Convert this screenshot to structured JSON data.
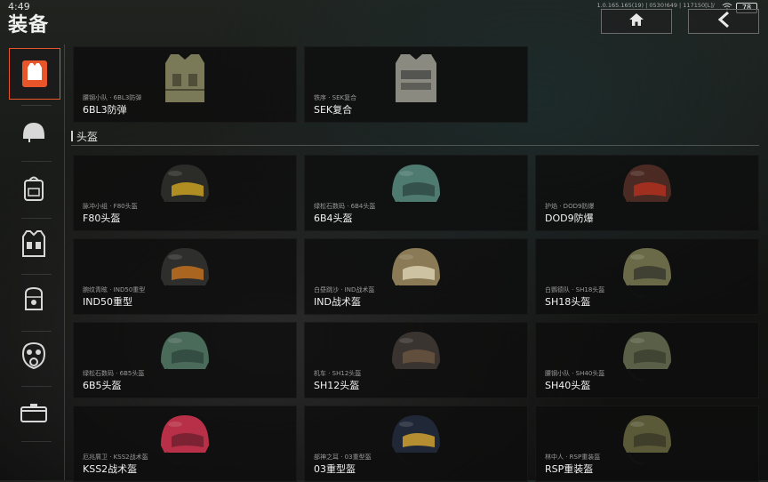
{
  "status": {
    "time": "4:49",
    "sysinfo": "1.0.165.165(19) | 0530!649 | 117150[L]/",
    "battery": "78"
  },
  "header": {
    "title": "装备",
    "home_icon": "home-icon",
    "back_icon": "back-arrow-icon"
  },
  "sidebar": {
    "items": [
      {
        "name": "vest-icon",
        "active": true
      },
      {
        "name": "helmet-icon",
        "active": false
      },
      {
        "name": "backpack-icon",
        "active": false
      },
      {
        "name": "chest-rig-icon",
        "active": false
      },
      {
        "name": "pouch-icon",
        "active": false
      },
      {
        "name": "gas-mask-icon",
        "active": false
      },
      {
        "name": "container-icon",
        "active": false
      }
    ]
  },
  "armor": [
    {
      "sub": "腰钢小队 · 6BL3防弹",
      "name": "6BL3防弹",
      "color": "#7a7a58"
    },
    {
      "sub": "铁序 · SEK复合",
      "name": "SEK复合",
      "color": "#8a8a80"
    }
  ],
  "section": {
    "helmets_label": "头盔"
  },
  "helmets": [
    {
      "sub": "脉冲小组 · F80头盔",
      "name": "F80头盔",
      "color": "#2b2b28",
      "visor": "#c8a020"
    },
    {
      "sub": "绿松石数码 · 6B4头盔",
      "name": "6B4头盔",
      "color": "#4f7a70",
      "visor": "#2f4a44"
    },
    {
      "sub": "护焰 · DOD9防爆",
      "name": "DOD9防爆",
      "color": "#4a2a22",
      "visor": "#b03020"
    },
    {
      "sub": "腕纹青眩 · IND50重型",
      "name": "IND50重型",
      "color": "#2e2e2c",
      "visor": "#c07020"
    },
    {
      "sub": "白昼跳沙 · IND战术盔",
      "name": "IND战术盔",
      "color": "#8a7a55",
      "visor": "#d8d0b0"
    },
    {
      "sub": "白鹦德队 · SH18头盔",
      "name": "SH18头盔",
      "color": "#6a6a48",
      "visor": "#3a3a30"
    },
    {
      "sub": "绿松石数码 · 6B5头盔",
      "name": "6B5头盔",
      "color": "#4a6a5a",
      "visor": "#30483e"
    },
    {
      "sub": "机车 · SH12头盔",
      "name": "SH12头盔",
      "color": "#3a3430",
      "visor": "#6a5440"
    },
    {
      "sub": "腰钢小队 · SH40头盔",
      "name": "SH40头盔",
      "color": "#5a6048",
      "visor": "#3c4030"
    },
    {
      "sub": "厄兆屑卫 · KSS2战术盔",
      "name": "KSS2战术盔",
      "color": "#b83048",
      "visor": "#702030"
    },
    {
      "sub": "部神之耳 · 03重型盔",
      "name": "03重型盔",
      "color": "#202838",
      "visor": "#d0a030"
    },
    {
      "sub": "林中人 · RSP重装盔",
      "name": "RSP重装盔",
      "color": "#5a5a38",
      "visor": "#3a3a28"
    }
  ]
}
